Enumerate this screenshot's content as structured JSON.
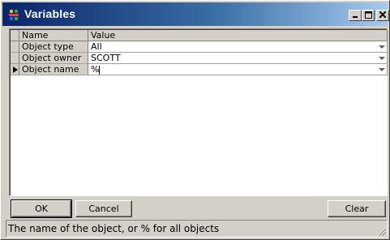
{
  "window": {
    "title": "Variables"
  },
  "grid": {
    "headers": {
      "name": "Name",
      "value": "Value"
    },
    "rows": [
      {
        "name": "Object type",
        "value": "All"
      },
      {
        "name": "Object owner",
        "value": "SCOTT"
      },
      {
        "name": "Object name",
        "value": "%"
      }
    ],
    "current_row_indicator": "triangle-right-icon"
  },
  "buttons": {
    "ok": "OK",
    "cancel": "Cancel",
    "clear": "Clear"
  },
  "statusbar": {
    "text": "The name of the object, or % for all objects"
  },
  "colors": {
    "title_start": "#0a246a",
    "title_end": "#a6caf0",
    "face": "#d4d0c8"
  }
}
